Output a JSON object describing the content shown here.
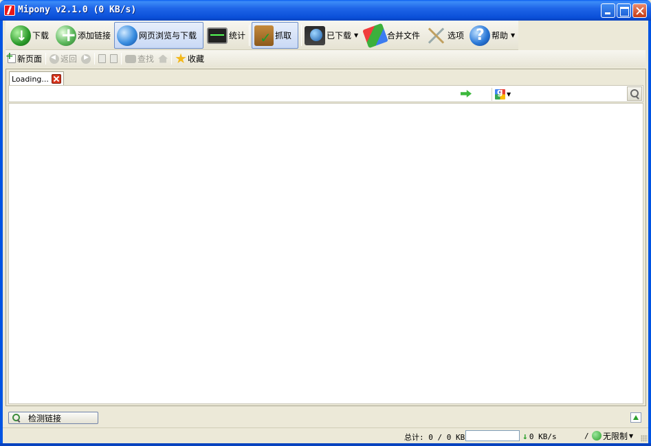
{
  "window": {
    "title": "Mipony v2.1.0 (0 KB/s)"
  },
  "main_toolbar": {
    "download": "下载",
    "add_links": "添加链接",
    "web_browse_download": "网页浏览与下载",
    "stats": "统计",
    "grab": "抓取",
    "downloaded": "已下载",
    "merge_files": "合并文件",
    "options": "选项",
    "help": "帮助"
  },
  "nav_toolbar": {
    "new_page": "新页面",
    "back": "返回",
    "find": "查找",
    "favorites": "收藏"
  },
  "browser": {
    "tabs": [
      {
        "label": "Loading..."
      }
    ],
    "address": {
      "value": ""
    },
    "search": {
      "value": ""
    }
  },
  "bottom": {
    "check_links": "检测链接"
  },
  "statusbar": {
    "total": "总计: 0 / 0 KB",
    "progress_fraction": 0,
    "speed": "0 KB/s",
    "separator": "/",
    "limit": "无限制"
  }
}
